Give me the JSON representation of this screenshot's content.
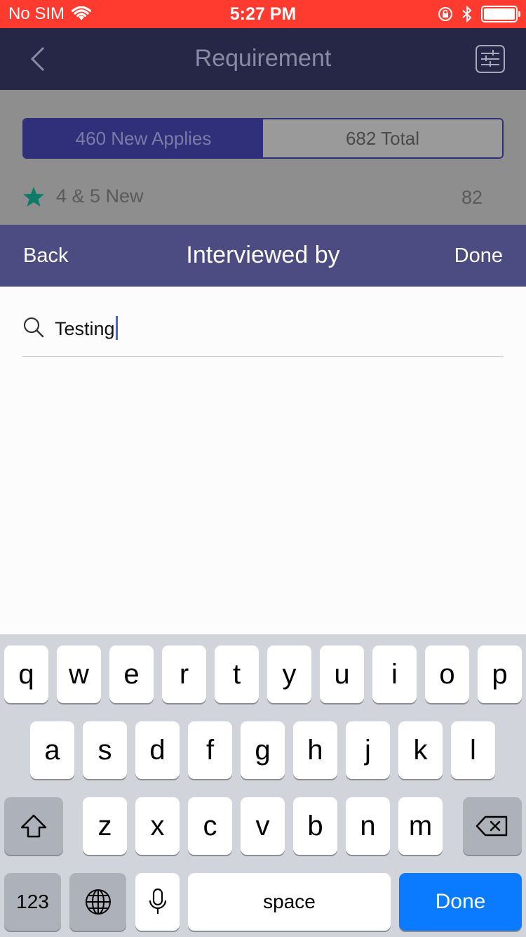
{
  "status_bar": {
    "carrier": "No SIM",
    "time": "5:27 PM"
  },
  "nav": {
    "title": "Requirement"
  },
  "segments": [
    {
      "label": "460 New Applies",
      "active": true
    },
    {
      "label": "682 Total",
      "active": false
    }
  ],
  "rating": {
    "label": "4 & 5 New",
    "count": "82"
  },
  "modal": {
    "back_label": "Back",
    "title": "Interviewed by",
    "done_label": "Done",
    "search_value": "Testing"
  },
  "keyboard": {
    "row1": [
      "q",
      "w",
      "e",
      "r",
      "t",
      "y",
      "u",
      "i",
      "o",
      "p"
    ],
    "row2": [
      "a",
      "s",
      "d",
      "f",
      "g",
      "h",
      "j",
      "k",
      "l"
    ],
    "row3": [
      "z",
      "x",
      "c",
      "v",
      "b",
      "n",
      "m"
    ],
    "numbers_label": "123",
    "space_label": "space",
    "done_label": "Done"
  },
  "colors": {
    "status_bar": "#ff3b30",
    "modal_header": "#4c4c82",
    "accent_done": "#0a7aff",
    "star": "#0e7a6a"
  }
}
